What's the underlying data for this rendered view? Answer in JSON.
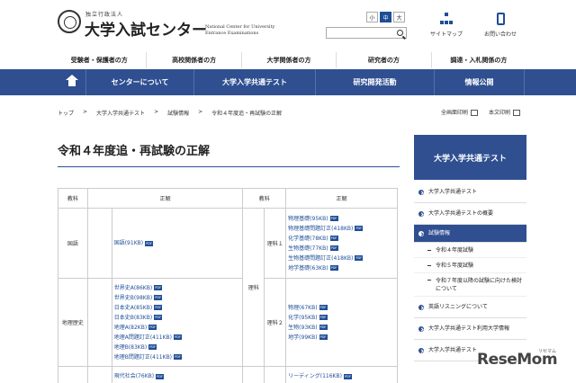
{
  "header": {
    "logo_sub": "独立行政法人",
    "logo_main": "大学入試センター",
    "logo_en": "National Center for University Entrance Examinations",
    "font_sizes": [
      "小",
      "中",
      "大"
    ],
    "active_font_size": "中",
    "search_placeholder": "",
    "sitemap_label": "サイトマップ",
    "contact_label": "お問い合わせ"
  },
  "audience_nav": [
    "受験者・保護者の方",
    "高校関係者の方",
    "大学関係者の方",
    "研究者の方",
    "調達・入札関係の方"
  ],
  "main_nav": [
    "センターについて",
    "大学入学共通テスト",
    "研究開発活動",
    "情報公開"
  ],
  "breadcrumb": [
    "トップ",
    "大学入学共通テスト",
    "試験情報",
    "令和４年度追・再試験の正解"
  ],
  "print": {
    "full": "全画面印刷",
    "text": "本文印刷"
  },
  "page_title": "令和４年度追・再試験の正解",
  "table": {
    "headers": [
      "教科",
      "正解",
      "教科",
      "正解"
    ],
    "pdf_label": "PDF",
    "rows": [
      {
        "left_subject": "国語",
        "left_files": [
          "国語(91KB)"
        ],
        "right_group": "理科",
        "right_subject": "理科１",
        "right_files": [
          "物理基礎(95KB)",
          "物理基礎問題訂正(418KB)",
          "化学基礎(78KB)",
          "生物基礎(77KB)",
          "生物基礎問題訂正(418KB)",
          "地学基礎(63KB)"
        ]
      },
      {
        "left_subject": "地理歴史",
        "left_files": [
          "世界史A(86KB)",
          "世界史B(98KB)",
          "日本史A(85KB)",
          "日本史B(83KB)",
          "地理A(82KB)",
          "地理A問題訂正(411KB)",
          "地理B(83KB)",
          "地理B問題訂正(411KB)"
        ],
        "right_subject": "理科２",
        "right_files": [
          "物理(67KB)",
          "化学(95KB)",
          "生物(93KB)",
          "地学(99KB)"
        ]
      },
      {
        "left_subject": "",
        "left_files": [
          "現代社会(76KB)"
        ],
        "right_subject": "",
        "right_files": [
          "リーディング(116KB)"
        ]
      }
    ]
  },
  "sidebar": {
    "heading": "大学入学共通テスト",
    "items": [
      {
        "label": "大学入学共通テスト",
        "type": "item"
      },
      {
        "label": "大学入学共通テストの概要",
        "type": "item"
      },
      {
        "label": "試験情報",
        "type": "active"
      },
      {
        "label": "令和４年度試験",
        "type": "sub"
      },
      {
        "label": "令和５年度試験",
        "type": "sub"
      },
      {
        "label": "令和７年度以降の試験に向けた検討について",
        "type": "sub-tall"
      },
      {
        "label": "英語リスニングについて",
        "type": "item"
      },
      {
        "label": "大学入学共通テスト利用大学情報",
        "type": "item"
      },
      {
        "label": "大学入学共通テスト",
        "type": "item"
      }
    ]
  },
  "watermark": {
    "main": "ReseMom",
    "sub": "リセマム"
  },
  "colors": {
    "nav_blue": "#2f4f91",
    "link_blue": "#1f4e96"
  }
}
